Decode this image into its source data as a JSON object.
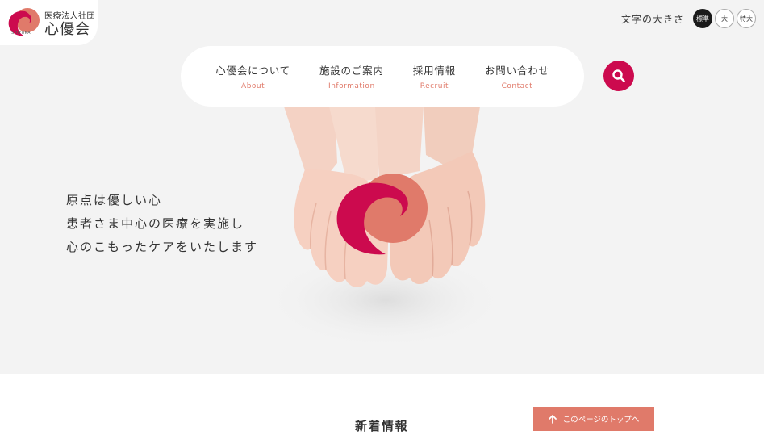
{
  "brand": {
    "corporation": "医療法人社団",
    "name": "心優会",
    "romaji": "SHIYUKAI",
    "colors": {
      "crimson": "#cc0a4e",
      "coral": "#e07a6a"
    }
  },
  "font_size": {
    "label": "文字の大きさ",
    "options": [
      "標準",
      "大",
      "特大"
    ],
    "selected": "標準"
  },
  "nav": {
    "items": [
      {
        "label": "心優会について",
        "sub": "About"
      },
      {
        "label": "施設のご案内",
        "sub": "Information"
      },
      {
        "label": "採用情報",
        "sub": "Recruit"
      },
      {
        "label": "お問い合わせ",
        "sub": "Contact"
      }
    ],
    "search_icon": "search-icon"
  },
  "hero": {
    "lines": [
      "原点は優しい心",
      "患者さま中心の医療を実施し",
      "心のこもったケアをいたします"
    ]
  },
  "news": {
    "heading": "新着情報"
  },
  "to_top": {
    "label": "このページのトップへ",
    "icon": "arrow-up-icon"
  }
}
